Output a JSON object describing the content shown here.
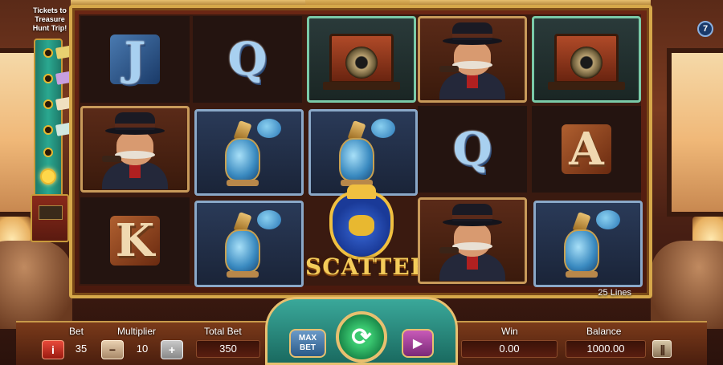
{
  "sidebar": {
    "title_line1": "Tickets to",
    "title_line2": "Treasure",
    "title_line3": "Hunt Trip!"
  },
  "reels": {
    "grid": [
      [
        "J",
        "Q",
        "camera",
        "man",
        "camera"
      ],
      [
        "man",
        "perfume",
        "perfume",
        "Q",
        "A"
      ],
      [
        "K",
        "perfume",
        "scatter",
        "man",
        "perfume"
      ]
    ],
    "scatter_label": "SCATTER"
  },
  "lines_label": "25 Lines",
  "info_label": "7",
  "controls": {
    "bet_label": "Bet",
    "bet_value": "35",
    "multiplier_label": "Multiplier",
    "multiplier_value": "10",
    "total_bet_label": "Total Bet",
    "total_bet_value": "350",
    "win_label": "Win",
    "win_value": "0.00",
    "balance_label": "Balance",
    "balance_value": "1000.00",
    "info_button": "i",
    "minus_button": "−",
    "plus_button": "+",
    "maxbet_line1": "MAX",
    "maxbet_line2": "BET"
  },
  "icons": {
    "spin": "spin-icon",
    "autoplay": "autoplay-icon",
    "menu": "menu-icon"
  },
  "colors": {
    "frame_gold": "#d6a84a",
    "spin_green": "#3ac870",
    "bet_red": "#e84a3a"
  }
}
